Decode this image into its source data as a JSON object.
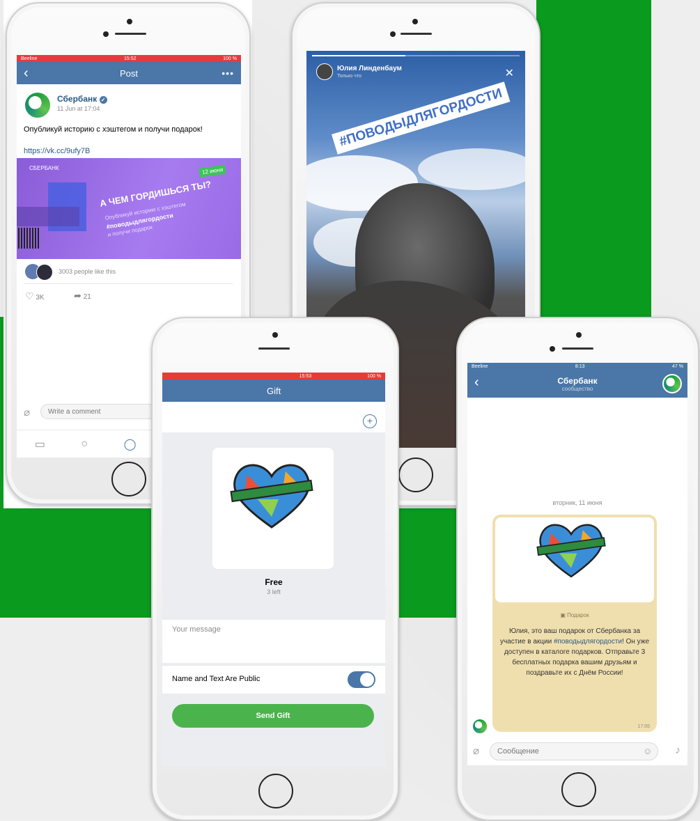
{
  "colors": {
    "accent": "#4a76a8",
    "green": "#0a9a1e",
    "send_green": "#4bb34b",
    "banner_purple": "#9a6be6"
  },
  "phone1": {
    "status": {
      "carrier": "Beeline",
      "time": "15:52",
      "battery": "100 %"
    },
    "nav_title": "Post",
    "author": "Сбербанк",
    "date": "11 Jun at 17:04",
    "post_text": "Опубликуй историю с хэштегом и получи подарок!",
    "post_link": "https://vk.cc/9ufy7B",
    "banner": {
      "brand": "СБЕРБАНК",
      "date_badge": "12 июня",
      "heading": "А ЧЕМ ГОРДИШЬСЯ ТЫ?",
      "line1": "Опубликуй историю с хэштегом",
      "hashtag": "#поводыдлягордости",
      "line2": "и получи подарок"
    },
    "likes_text": "3003 people like this",
    "like_count": "3K",
    "share_count": "21",
    "comment_placeholder": "Write a comment"
  },
  "phone2": {
    "story_author": "Юлия Линденбаум",
    "story_sub": "Только что",
    "hashtag": "#ПОВОДЫДЛЯГОРДОСТИ"
  },
  "phone3": {
    "status": {
      "time": "15:53",
      "battery": "100 %"
    },
    "nav_title": "Gift",
    "gift_price": "Free",
    "gift_left": "3 left",
    "message_placeholder": "Your message",
    "public_label": "Name and Text Are Public",
    "public_toggle_on": true,
    "send_button": "Send Gift"
  },
  "phone4": {
    "status": {
      "carrier": "Beeline",
      "time": "8:13",
      "battery": "47 %"
    },
    "chat_title": "Сбербанк",
    "chat_sub": "сообщество",
    "date_label": "вторник, 11 июня",
    "gift_label": "Подарок",
    "message_1": "Юлия, это ваш подарок от Сбербанка за участие в акции",
    "message_hashtag": "#поводыдлягордости",
    "message_2": "! Он уже доступен в каталоге подарков. Отправьте 3 бесплатных подарка вашим друзьям и поздравьте их с Днём России!",
    "message_time": "17:05",
    "input_placeholder": "Сообщение"
  }
}
